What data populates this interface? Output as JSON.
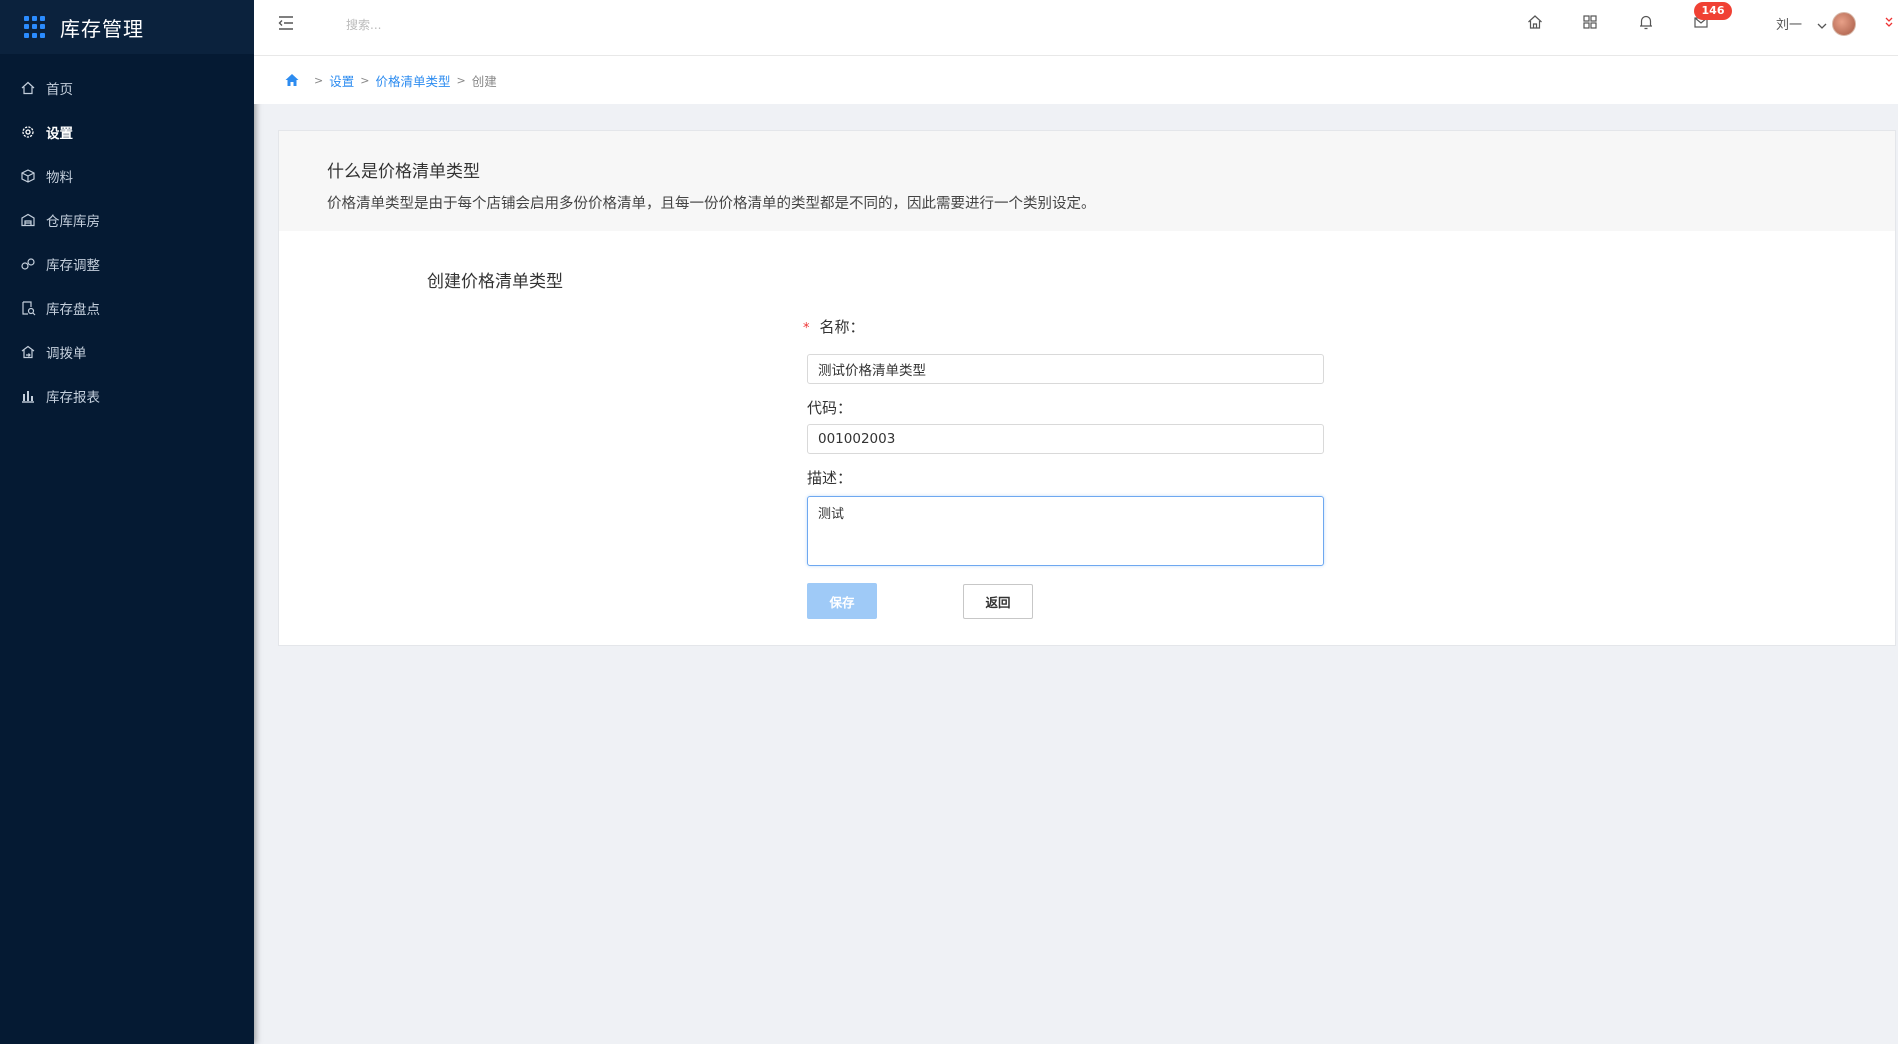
{
  "app": {
    "title": "库存管理"
  },
  "sidebar": {
    "items": [
      {
        "label": "首页",
        "icon": "home-icon"
      },
      {
        "label": "设置",
        "icon": "settings-icon"
      },
      {
        "label": "物料",
        "icon": "box-icon"
      },
      {
        "label": "仓库库房",
        "icon": "warehouse-icon"
      },
      {
        "label": "库存调整",
        "icon": "adjust-icon"
      },
      {
        "label": "库存盘点",
        "icon": "inventory-check-icon"
      },
      {
        "label": "调拨单",
        "icon": "transfer-icon"
      },
      {
        "label": "库存报表",
        "icon": "bar-chart-icon"
      }
    ],
    "active_index": 1
  },
  "header": {
    "search_placeholder": "搜索...",
    "badge_count": "146",
    "username": "刘一"
  },
  "breadcrumb": {
    "items": [
      "设置",
      "价格清单类型"
    ],
    "current": "创建"
  },
  "intro": {
    "title": "什么是价格清单类型",
    "description": "价格清单类型是由于每个店铺会启用多份价格清单，且每一份价格清单的类型都是不同的，因此需要进行一个类别设定。"
  },
  "form": {
    "title": "创建价格清单类型",
    "name_label": "名称：",
    "name_value": "测试价格清单类型",
    "code_label": "代码：",
    "code_value": "001002003",
    "desc_label": "描述：",
    "desc_value": "测试",
    "save_label": "保存",
    "back_label": "返回"
  },
  "colors": {
    "sidebar_bg": "#051a33",
    "accent": "#2d8cf0",
    "badge": "#f04134",
    "save_button": "#9fcaf7"
  }
}
